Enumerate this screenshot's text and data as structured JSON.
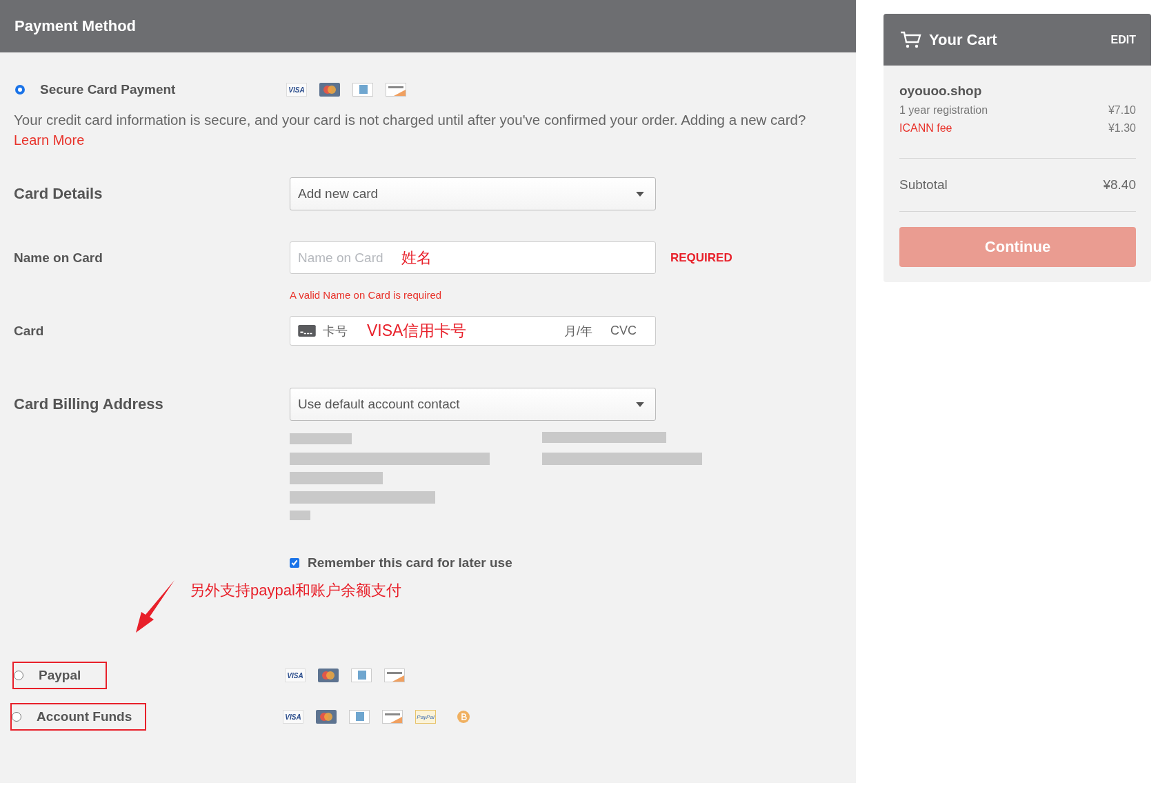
{
  "payment_panel": {
    "title": "Payment Method",
    "options": [
      {
        "label": "Secure Card Payment",
        "selected": true,
        "annotated": false,
        "logos": [
          {
            "kind": "visa",
            "text": "VISA"
          },
          {
            "kind": "mastercard"
          },
          {
            "kind": "amex"
          },
          {
            "kind": "discover"
          }
        ]
      },
      {
        "label": "Paypal",
        "selected": false,
        "annotated": true,
        "logos": [
          {
            "kind": "visa",
            "text": "VISA"
          },
          {
            "kind": "mastercard"
          },
          {
            "kind": "amex"
          },
          {
            "kind": "discover"
          }
        ]
      },
      {
        "label": "Account Funds",
        "selected": false,
        "annotated": true,
        "logos": [
          {
            "kind": "visa",
            "text": "VISA"
          },
          {
            "kind": "mastercard"
          },
          {
            "kind": "amex"
          },
          {
            "kind": "discover"
          },
          {
            "kind": "paypal",
            "text": "PayPal"
          },
          {
            "kind": "bitcoin"
          }
        ]
      }
    ],
    "description": "Your credit card information is secure, and your card is not charged until after you've confirmed your order. Adding a new card?",
    "learn_more": "Learn More",
    "card_details": {
      "label": "Card Details",
      "value": "Add new card"
    },
    "name_on_card": {
      "label": "Name on Card",
      "placeholder": "Name on Card",
      "annotation": "姓名",
      "required": "REQUIRED",
      "error": "A valid Name on Card is required"
    },
    "card": {
      "label": "Card",
      "placeholder": "卡号",
      "annotation": "VISA信用卡号",
      "expiry_placeholder": "月/年",
      "cvc_placeholder": "CVC"
    },
    "billing_address": {
      "label": "Card Billing Address",
      "value": "Use default account contact"
    },
    "remember_card": {
      "label": "Remember this card for later use",
      "checked": true
    },
    "annotation_note": "另外支持paypal和账户余额支付"
  },
  "cart": {
    "title": "Your Cart",
    "edit": "EDIT",
    "item": {
      "name": "oyouoo.shop",
      "lines": [
        {
          "kind": "plain",
          "label": "1 year registration",
          "price": "¥7.10"
        },
        {
          "kind": "link",
          "label": "ICANN fee",
          "price": "¥1.30"
        }
      ]
    },
    "subtotal": {
      "label": "Subtotal",
      "value": "¥8.40"
    },
    "button": "Continue"
  }
}
